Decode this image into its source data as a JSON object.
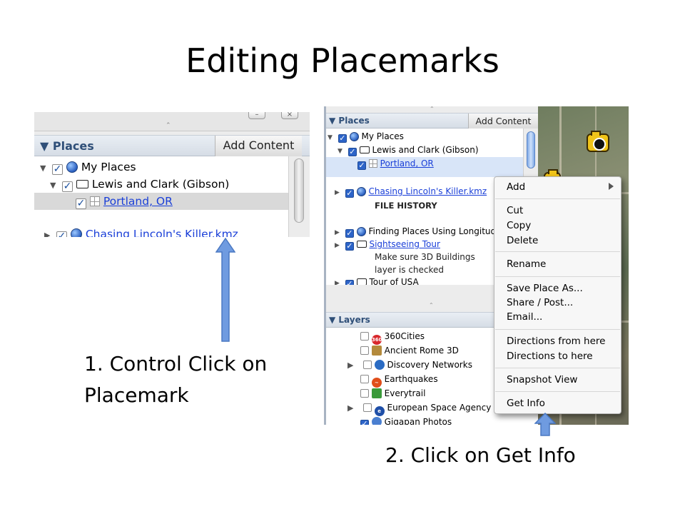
{
  "slide": {
    "title": "Editing Placemarks",
    "caption_1": "1. Control Click on Placemark",
    "caption_2": "2. Click on Get Info"
  },
  "left_shot": {
    "places_header": "Places",
    "add_content": "Add Content",
    "tree": [
      {
        "label": "My Places"
      },
      {
        "label": "Lewis and Clark (Gibson)"
      },
      {
        "label": "Portland, OR"
      },
      {
        "label": "Chasing Lincoln's Killer.kmz"
      }
    ]
  },
  "right_shot": {
    "places_header": "Places",
    "add_content": "Add Content",
    "tree": [
      {
        "label": "My Places"
      },
      {
        "label": "Lewis and Clark (Gibson)"
      },
      {
        "label": "Portland, OR"
      },
      {
        "label": "Chasing Lincoln's Killer.kmz"
      },
      {
        "label": "FILE HISTORY"
      },
      {
        "label": "Finding Places Using Longitude"
      },
      {
        "label": "Sightseeing Tour"
      },
      {
        "label": "Make sure 3D Buildings"
      },
      {
        "label": "layer is checked"
      },
      {
        "label": "Tour of USA"
      }
    ],
    "layers_header": "Layers",
    "layers": [
      {
        "label": "360Cities"
      },
      {
        "label": "Ancient Rome 3D"
      },
      {
        "label": "Discovery Networks"
      },
      {
        "label": "Earthquakes"
      },
      {
        "label": "Everytrail"
      },
      {
        "label": "European Space Agency"
      },
      {
        "label": "Gigapan Photos"
      }
    ],
    "context_menu": {
      "add": "Add",
      "cut": "Cut",
      "copy": "Copy",
      "delete": "Delete",
      "rename": "Rename",
      "save_place_as": "Save Place As...",
      "share_post": "Share / Post...",
      "email": "Email...",
      "directions_from": "Directions from here",
      "directions_to": "Directions to here",
      "snapshot_view": "Snapshot View",
      "get_info": "Get Info"
    }
  },
  "colors": {
    "arrow_fill": "#6f9be0",
    "link": "#1a3fd8",
    "header_text": "#2f4f78",
    "selection": "#d8e5f8"
  }
}
